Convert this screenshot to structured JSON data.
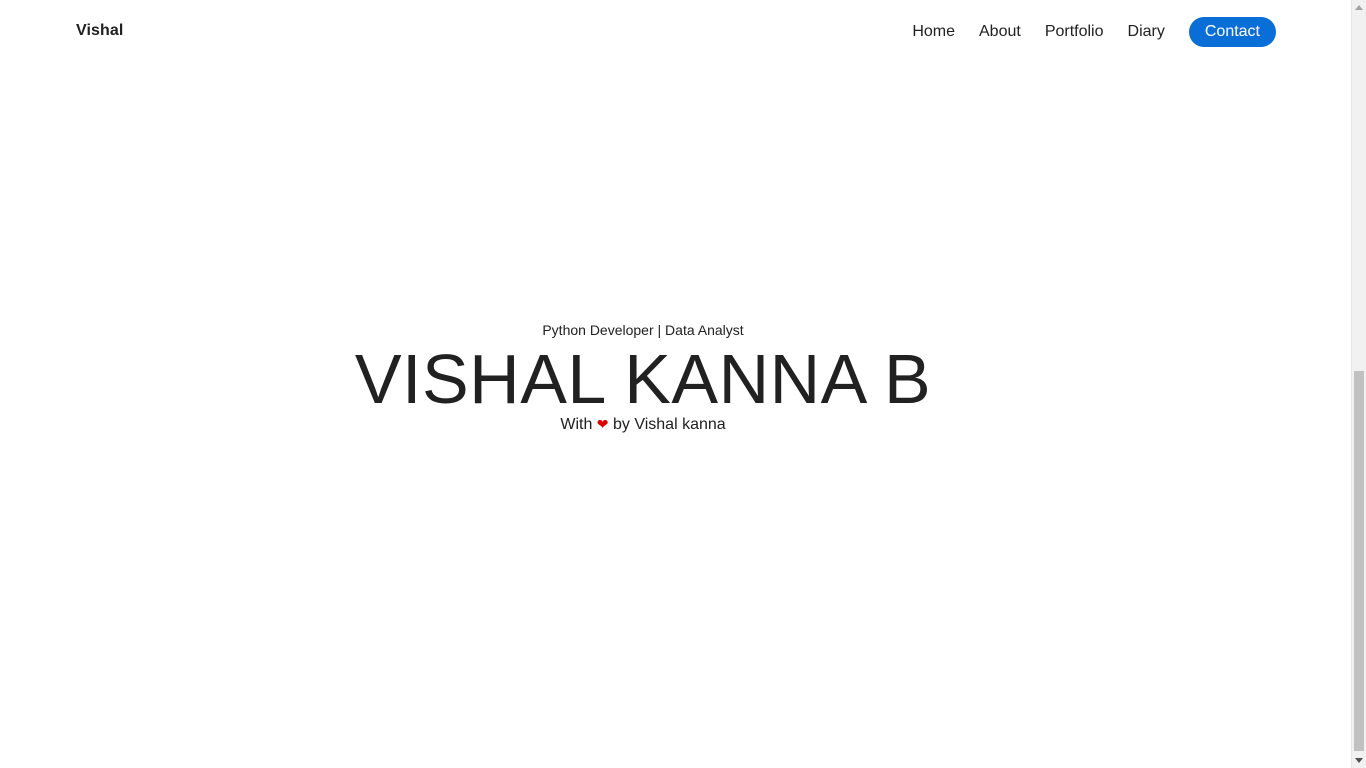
{
  "navbar": {
    "brand": "Vishal",
    "links": [
      "Home",
      "About",
      "Portfolio",
      "Diary"
    ],
    "contact_label": "Contact",
    "accent_color": "#0a6ed7"
  },
  "hero": {
    "subtitle": "Python Developer | Data Analyst",
    "name": "VISHAL KANNA B",
    "credit_prefix": "With",
    "heart_glyph": "❤",
    "credit_suffix": "by Vishal kanna",
    "heart_color": "#e00000"
  },
  "scrollbar": {
    "scroll_position": 0.48
  }
}
